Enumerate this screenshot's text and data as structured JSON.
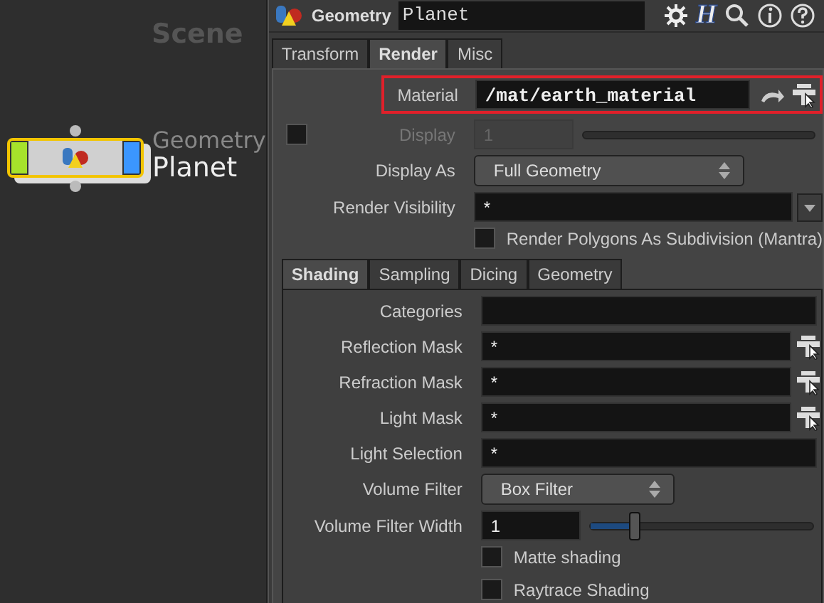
{
  "network": {
    "title": "Scene",
    "node": {
      "type_label": "Geometry",
      "name": "Planet",
      "selected": true,
      "flags": [
        {
          "on": true,
          "color": "#a6e22b"
        },
        {
          "on": true,
          "color": "#3b96ff"
        }
      ]
    }
  },
  "header": {
    "type_label": "Geometry",
    "name": "Planet",
    "h_button": "H"
  },
  "tabs": [
    {
      "label": "Transform",
      "selected": false
    },
    {
      "label": "Render",
      "selected": true
    },
    {
      "label": "Misc",
      "selected": false
    }
  ],
  "render_params": [
    {
      "kind": "material",
      "label": "Material",
      "value": "/mat/earth_material",
      "highlighted": true
    },
    {
      "kind": "toggle_slider",
      "label": "Display",
      "value": "1",
      "checked": false,
      "disabled": true
    },
    {
      "kind": "menu",
      "label": "Display As",
      "value": "Full Geometry"
    },
    {
      "kind": "menu_field",
      "label": "Render Visibility",
      "value": "*"
    },
    {
      "kind": "checkbox",
      "label": "Render Polygons As Subdivision (Mantra)",
      "checked": false
    }
  ],
  "subtabs": [
    {
      "label": "Shading",
      "selected": true
    },
    {
      "label": "Sampling",
      "selected": false
    },
    {
      "label": "Dicing",
      "selected": false
    },
    {
      "label": "Geometry",
      "selected": false
    }
  ],
  "shading_params": [
    {
      "kind": "field",
      "label": "Categories",
      "picker": false
    },
    {
      "kind": "field",
      "label": "Reflection Mask",
      "value": "*",
      "picker": true
    },
    {
      "kind": "field",
      "label": "Refraction Mask",
      "value": "*",
      "picker": true
    },
    {
      "kind": "field",
      "label": "Light Mask",
      "value": "*",
      "picker": true
    },
    {
      "kind": "field",
      "label": "Light Selection",
      "value": "*",
      "picker": false
    },
    {
      "kind": "menu",
      "label": "Volume Filter",
      "value": "Box Filter"
    },
    {
      "kind": "slider",
      "label": "Volume Filter Width",
      "value": "1",
      "level": 0.2
    },
    {
      "kind": "checkbox",
      "label": "Matte shading",
      "checked": false
    },
    {
      "kind": "checkbox",
      "label": "Raytrace Shading",
      "checked": false
    }
  ]
}
